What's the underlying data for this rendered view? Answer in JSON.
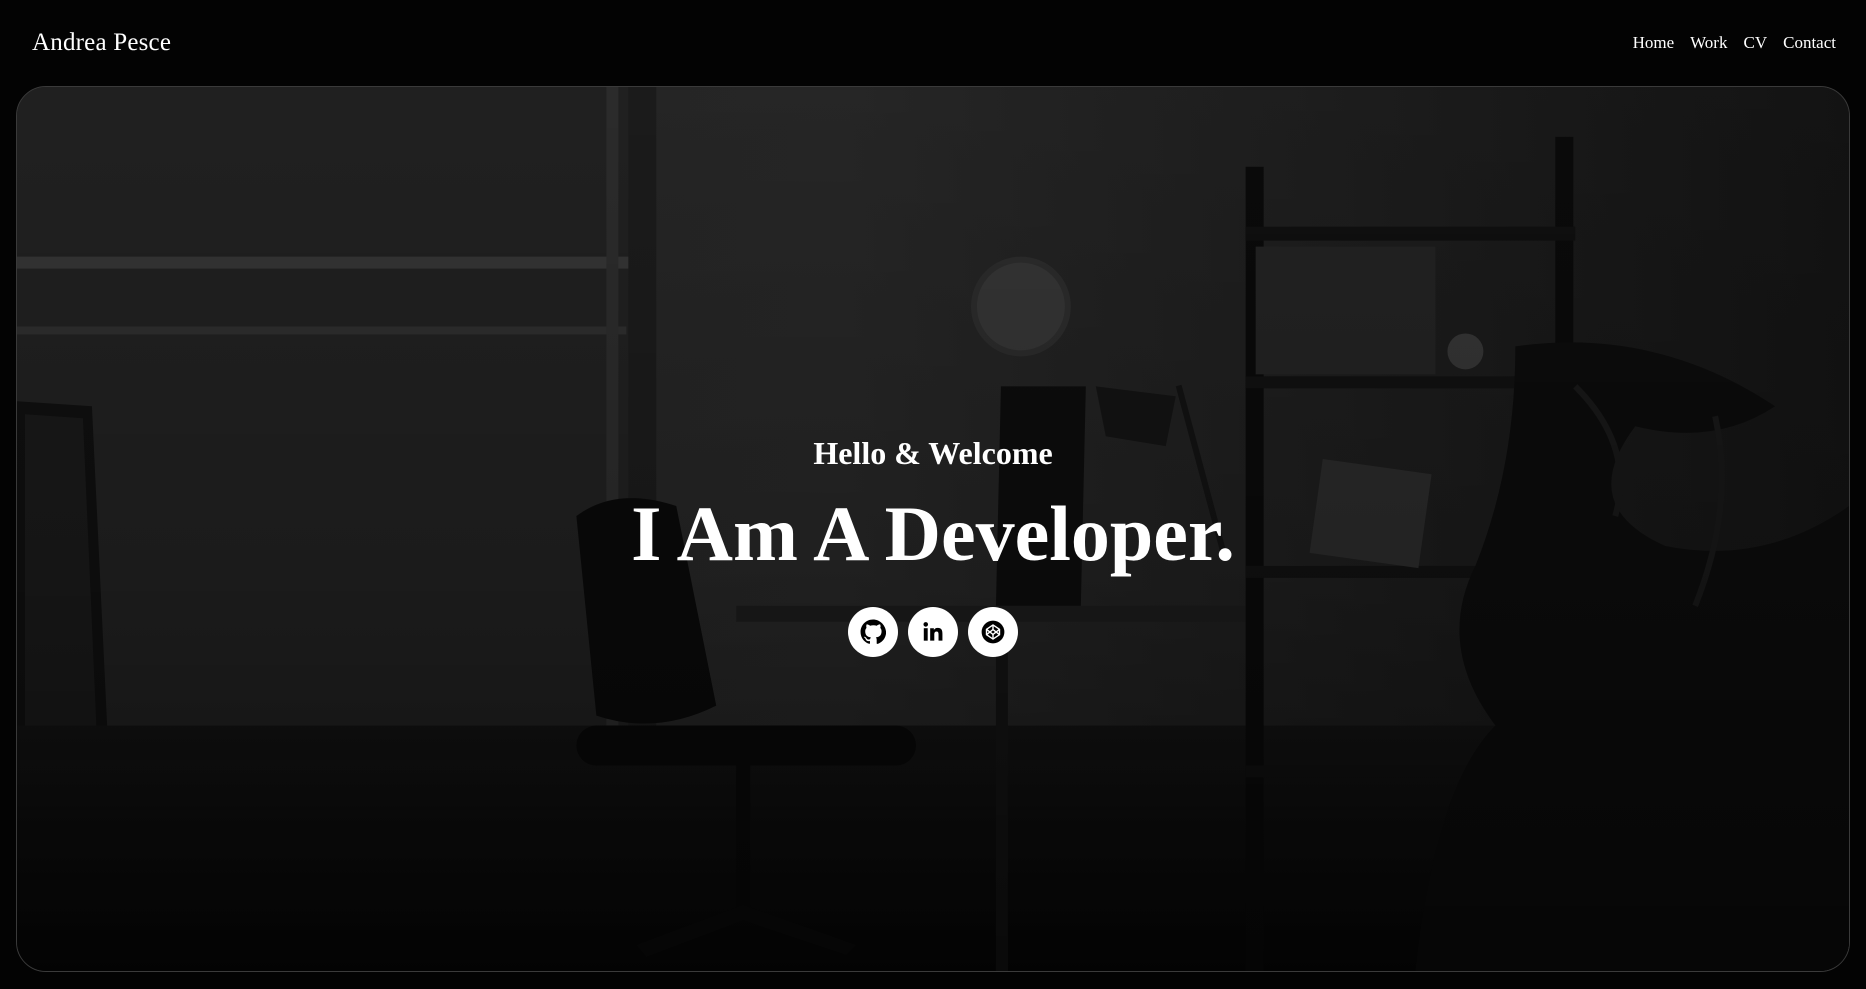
{
  "header": {
    "brand": "Andrea Pesce",
    "nav": [
      {
        "label": "Home"
      },
      {
        "label": "Work"
      },
      {
        "label": "CV"
      },
      {
        "label": "Contact"
      }
    ]
  },
  "hero": {
    "greeting": "Hello & Welcome",
    "headline_regular": "I Am ",
    "headline_bold": "A Developer.",
    "socials": [
      {
        "icon": "github-icon"
      },
      {
        "icon": "linkedin-icon"
      },
      {
        "icon": "codepen-icon"
      }
    ]
  },
  "colors": {
    "page_background": "#030303",
    "text": "#ffffff",
    "icon_button_background": "#ffffff",
    "icon_glyph": "#000000"
  }
}
